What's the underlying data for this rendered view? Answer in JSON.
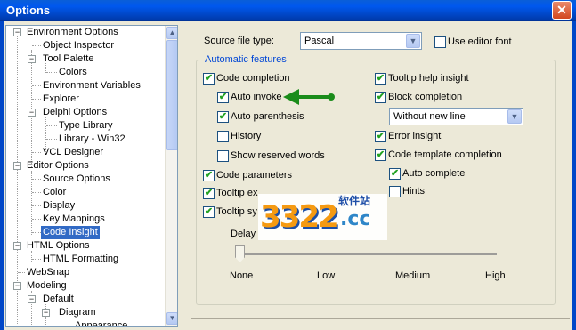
{
  "window": {
    "title": "Options",
    "close_glyph": "✕"
  },
  "tree": {
    "items": [
      {
        "label": "Environment Options",
        "box": "−"
      },
      {
        "label": "Object Inspector"
      },
      {
        "label": "Tool Palette",
        "box": "−"
      },
      {
        "label": "Colors"
      },
      {
        "label": "Environment Variables"
      },
      {
        "label": "Explorer"
      },
      {
        "label": "Delphi Options",
        "box": "−"
      },
      {
        "label": "Type Library"
      },
      {
        "label": "Library - Win32"
      },
      {
        "label": "VCL Designer"
      },
      {
        "label": "Editor Options",
        "box": "−"
      },
      {
        "label": "Source Options"
      },
      {
        "label": "Color"
      },
      {
        "label": "Display"
      },
      {
        "label": "Key Mappings"
      },
      {
        "label": "Code Insight",
        "selected": true
      },
      {
        "label": "HTML Options",
        "box": "−"
      },
      {
        "label": "HTML Formatting"
      },
      {
        "label": "WebSnap"
      },
      {
        "label": "Modeling",
        "box": "−"
      },
      {
        "label": "Default",
        "box": "−"
      },
      {
        "label": "Diagram",
        "box": "−"
      },
      {
        "label": "Appearance"
      }
    ],
    "scroll_up": "▲",
    "scroll_down": "▼"
  },
  "source_file_type": {
    "label": "Source file type:",
    "value": "Pascal",
    "arrow": "▼"
  },
  "use_editor_font": {
    "label": "Use editor font",
    "checked": false
  },
  "automatic_features": {
    "title": "Automatic features",
    "code_completion": {
      "label": "Code completion",
      "checked": true
    },
    "auto_invoke": {
      "label": "Auto invoke",
      "checked": true
    },
    "auto_parenthesis": {
      "label": "Auto parenthesis",
      "checked": true
    },
    "history": {
      "label": "History",
      "checked": false
    },
    "show_reserved_words": {
      "label": "Show reserved words",
      "checked": false
    },
    "code_parameters": {
      "label": "Code parameters",
      "checked": true
    },
    "tooltip_expression": {
      "label": "Tooltip ex",
      "checked": true
    },
    "tooltip_symbol": {
      "label": "Tooltip sy",
      "checked": true
    },
    "tooltip_help_insight": {
      "label": "Tooltip help insight",
      "checked": true
    },
    "block_completion": {
      "label": "Block completion",
      "checked": true
    },
    "block_mode": {
      "value": "Without new line",
      "arrow": "▼"
    },
    "error_insight": {
      "label": "Error insight",
      "checked": true
    },
    "code_template_completion": {
      "label": "Code template completion",
      "checked": true
    },
    "auto_complete": {
      "label": "Auto complete",
      "checked": true
    },
    "hints": {
      "label": "Hints",
      "checked": false
    }
  },
  "delay": {
    "label": "Delay",
    "ticks": [
      "None",
      "Low",
      "Medium",
      "High"
    ],
    "value": "None"
  },
  "watermark": {
    "main": "3322",
    "suffix": ".cc",
    "sub": "软件站"
  },
  "colors": {
    "accent": "#316AC5",
    "check": "#21A121",
    "annotation_arrow": "#1A8C1A",
    "titlebar": "#0058EE"
  },
  "icons": {
    "check": "✔"
  }
}
